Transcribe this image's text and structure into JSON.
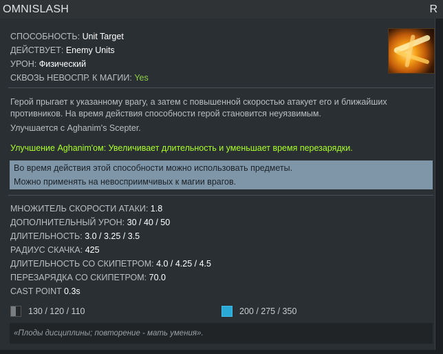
{
  "ability": {
    "name": "OMNISLASH",
    "hotkey": "R",
    "icon": "omnislash-ability-icon"
  },
  "properties": [
    {
      "label": "СПОСОБНОСТЬ:",
      "value": "Unit Target"
    },
    {
      "label": "ДЕЙСТВУЕТ:",
      "value": "Enemy Units"
    },
    {
      "label": "УРОН:",
      "value": "Физический"
    },
    {
      "label": "СКВОЗЬ НЕВОСПР. К МАГИИ:",
      "value": "Yes"
    }
  ],
  "description": {
    "text": "Герой прыгает к указанному врагу, а затем с повышенной скоростью атакует его и ближайших противников. На время действия способности герой становится неуязвимым.",
    "upgrade_note": "Улучшается с Aghanim's Scepter."
  },
  "aghanim_upgrade": "Улучшение Aghanim'ом: Увеличивает длительность и уменьшает время перезарядки.",
  "notes": [
    "Во время действия этой способности можно использовать предметы.",
    "Можно применять на невосприимчивых к магии врагов."
  ],
  "stats": [
    {
      "label": "МНОЖИТЕЛЬ СКОРОСТИ АТАКИ:",
      "value": "1.8"
    },
    {
      "label": "ДОПОЛНИТЕЛЬНЫЙ УРОН:",
      "value": "30 / 40 / 50"
    },
    {
      "label": "ДЛИТЕЛЬНОСТЬ:",
      "value": "3.0 / 3.25 / 3.5"
    },
    {
      "label": "РАДИУС СКАЧКА:",
      "value": "425"
    },
    {
      "label": "ДЛИТЕЛЬНОСТЬ СО СКИПЕТРОМ:",
      "value": "4.0 / 4.25 / 4.5"
    },
    {
      "label": "ПЕРЕЗАРЯДКА СО СКИПЕТРОМ:",
      "value": "70.0"
    },
    {
      "label": "CAST POINT",
      "value": "0.3s"
    }
  ],
  "costs": {
    "cooldown": {
      "icon": "cooldown-icon",
      "value": "130 / 120 / 110"
    },
    "mana": {
      "icon": "mana-icon",
      "value": "200 / 275 / 350",
      "color": "#2ba9d6"
    }
  },
  "lore": "«Плоды дисциплины; повторение - мать умения».",
  "colors": {
    "header_bg": "#2f3336",
    "panel_bg": "#2a2f33",
    "green_value": "#8fcf46",
    "aghanim_text": "#aaff2a",
    "note_bg": "#7f96a8"
  }
}
